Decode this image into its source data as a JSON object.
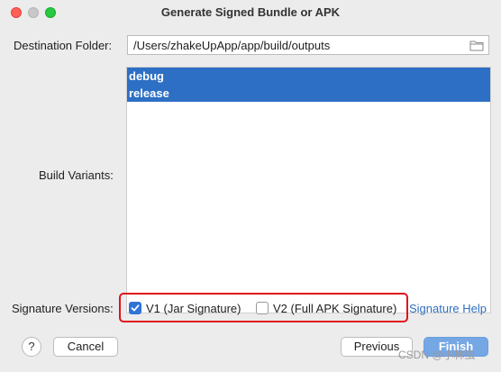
{
  "window": {
    "title": "Generate Signed Bundle or APK"
  },
  "destination": {
    "label": "Destination Folder:",
    "value": "/Users/zhakeUpApp/app/build/outputs",
    "browse_icon": "folder-icon"
  },
  "build_variants": {
    "label": "Build Variants:",
    "items": [
      {
        "label": "debug",
        "selected": true
      },
      {
        "label": "release",
        "selected": true
      }
    ]
  },
  "signature": {
    "label": "Signature Versions:",
    "v1": {
      "label": "V1 (Jar Signature)",
      "checked": true
    },
    "v2": {
      "label": "V2 (Full APK Signature)",
      "checked": false
    },
    "help_link": "Signature Help"
  },
  "footer": {
    "help_label": "?",
    "cancel_label": "Cancel",
    "previous_label": "Previous",
    "finish_label": "Finish"
  },
  "watermark": "CSDN @小林虫",
  "colors": {
    "selection": "#2d6fc4",
    "highlight_box": "#e1131b",
    "link": "#2f6ebd",
    "primary_button": "#75a7e5"
  }
}
